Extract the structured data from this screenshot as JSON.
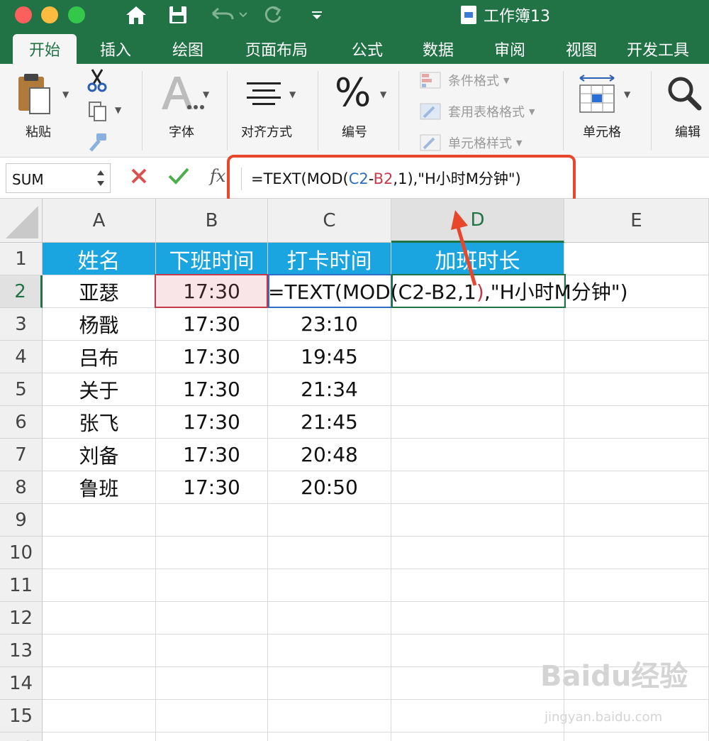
{
  "window": {
    "title": "工作簿13"
  },
  "quick_access": {
    "home_icon": "home-icon",
    "save_icon": "save-icon",
    "undo_icon": "undo-icon",
    "redo_icon": "redo-icon",
    "more_icon": "more-icon"
  },
  "tabs": [
    {
      "label": "开始",
      "active": true
    },
    {
      "label": "插入"
    },
    {
      "label": "绘图"
    },
    {
      "label": "页面布局"
    },
    {
      "label": "公式"
    },
    {
      "label": "数据"
    },
    {
      "label": "审阅"
    },
    {
      "label": "视图"
    },
    {
      "label": "开发工具"
    }
  ],
  "ribbon": {
    "paste": "粘贴",
    "font": "字体",
    "alignment": "对齐方式",
    "number": "编号",
    "conditional_format": "条件格式",
    "table_format": "套用表格格式",
    "cell_style": "单元格样式",
    "cells": "单元格",
    "edit": "编辑"
  },
  "formula_bar": {
    "name_box": "SUM",
    "fx": "fx",
    "formula_parts": [
      "=TEXT(MOD(",
      "C2",
      "-",
      "B2",
      ",1),\"H小时M分钟\")"
    ]
  },
  "columns": [
    "A",
    "B",
    "C",
    "D",
    "E"
  ],
  "rows": [
    "1",
    "2",
    "3",
    "4",
    "5",
    "6",
    "7",
    "8",
    "9",
    "10",
    "11",
    "12",
    "13",
    "14",
    "15",
    "16"
  ],
  "header_row": [
    "姓名",
    "下班时间",
    "打卡时间",
    "加班时长"
  ],
  "table": [
    [
      "亚瑟",
      "17:30",
      ""
    ],
    [
      "杨戬",
      "17:30",
      "23:10"
    ],
    [
      "吕布",
      "17:30",
      "19:45"
    ],
    [
      "关于",
      "17:30",
      "21:34"
    ],
    [
      "张飞",
      "17:30",
      "21:45"
    ],
    [
      "刘备",
      "17:30",
      "20:48"
    ],
    [
      "鲁班",
      "17:30",
      "20:50"
    ]
  ],
  "editing_cell": {
    "parts": [
      "=TEXT(MOD(",
      "C2-B2,1",
      ")",
      ",\"H小时M分钟\")"
    ]
  },
  "watermark": {
    "brand": "Baidu经验",
    "url": "jingyan.baidu.com"
  },
  "colors": {
    "excel_green": "#217346",
    "header_blue": "#1ba5e0",
    "annotation_red": "#e8472b",
    "ref_blue": "#2f6dc4",
    "ref_red": "#c43a4a"
  }
}
